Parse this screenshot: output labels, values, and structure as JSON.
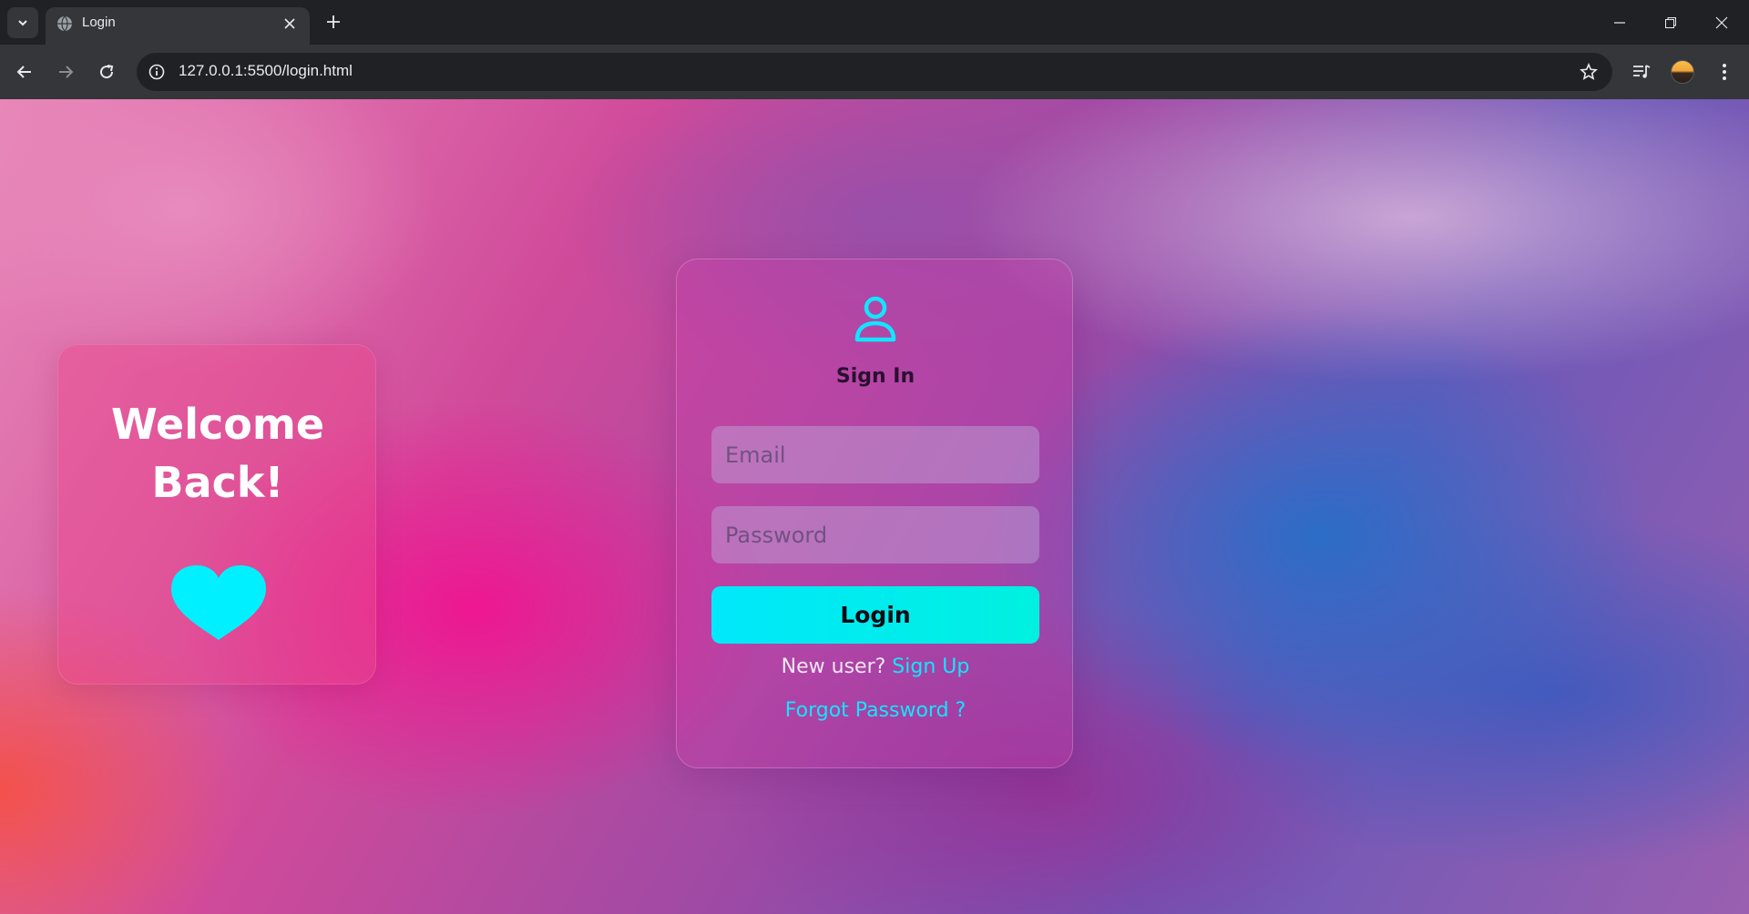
{
  "browser": {
    "tab_title": "Login",
    "url": "127.0.0.1:5500/login.html"
  },
  "page": {
    "welcome_title": "Welcome\nBack!",
    "signin_title": "Sign In",
    "email_placeholder": "Email",
    "password_placeholder": "Password",
    "login_label": "Login",
    "new_user_text": "New user?",
    "signup_label": "Sign Up",
    "forgot_label": "Forgot Password ?"
  },
  "colors": {
    "accent": "#00e8fb",
    "link": "#10e6ff"
  },
  "icons": [
    "tab-search-icon",
    "globe-icon",
    "close-icon",
    "plus-icon",
    "minimize-icon",
    "restore-icon",
    "window-close-icon",
    "back-arrow-icon",
    "forward-arrow-icon",
    "reload-icon",
    "info-icon",
    "star-icon",
    "reading-list-icon",
    "profile-avatar-icon",
    "kebab-menu-icon",
    "user-icon",
    "heart-icon"
  ]
}
